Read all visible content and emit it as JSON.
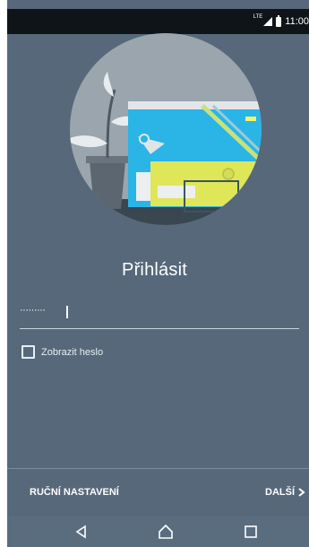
{
  "status": {
    "network": "LTE",
    "time": "11:00"
  },
  "screen": {
    "title": "Přihlásit"
  },
  "password": {
    "masked_value": "·········"
  },
  "show_password": {
    "label": "Zobrazit heslo",
    "checked": false
  },
  "footer": {
    "manual_setup": "RUČNÍ NASTAVENÍ",
    "next": "DALŠÍ",
    "next_icon": "chevron-right-icon"
  },
  "navbar": {
    "icons": [
      "back-icon",
      "home-icon",
      "recents-icon"
    ]
  },
  "colors": {
    "background": "#56687a",
    "status_bar": "#0f1418",
    "accent_mark": "#e0187a",
    "card_blue": "#2bb4e6",
    "card_yellow": "#dfe658"
  }
}
